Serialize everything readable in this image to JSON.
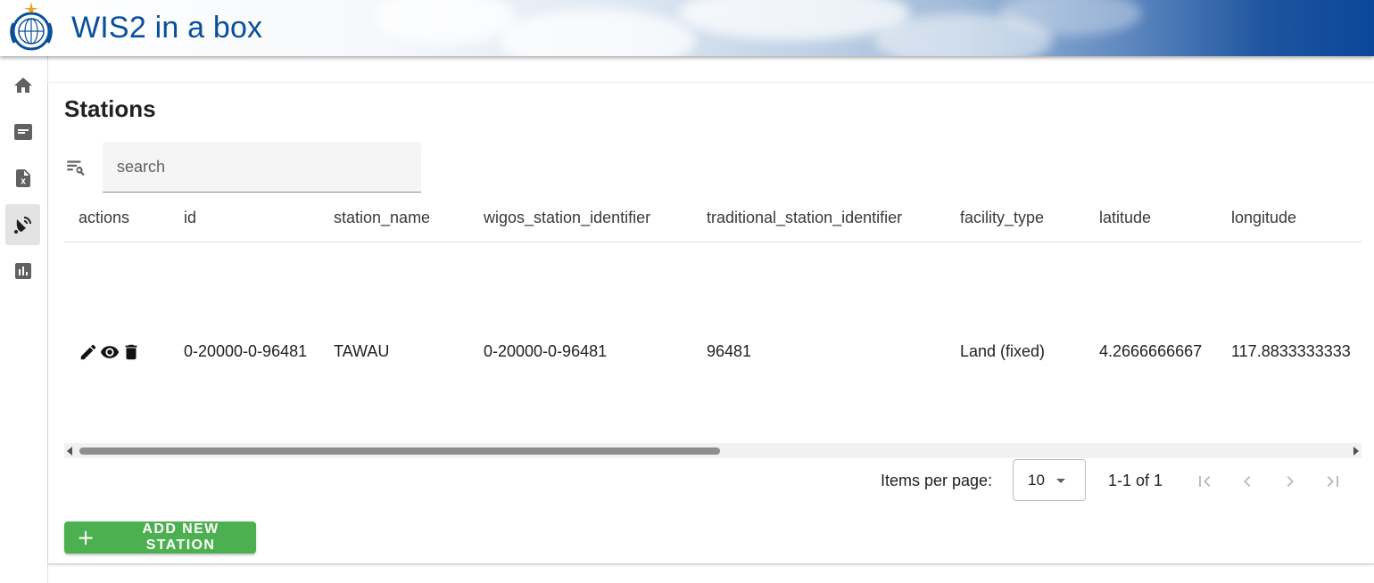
{
  "header": {
    "title": "WIS2 in a box"
  },
  "sidebar": {
    "items": [
      {
        "name": "home",
        "icon": "home-icon",
        "active": false
      },
      {
        "name": "messages",
        "icon": "message-icon",
        "active": false
      },
      {
        "name": "csv",
        "icon": "csv-file-icon",
        "active": false
      },
      {
        "name": "stations",
        "icon": "satellite-dish-icon",
        "active": true
      },
      {
        "name": "monitoring",
        "icon": "bar-chart-icon",
        "active": false
      }
    ]
  },
  "main": {
    "title": "Stations",
    "search": {
      "placeholder": "search",
      "value": ""
    },
    "table": {
      "columns": [
        "actions",
        "id",
        "station_name",
        "wigos_station_identifier",
        "traditional_station_identifier",
        "facility_type",
        "latitude",
        "longitude"
      ],
      "rows": [
        {
          "id": "0-20000-0-96481",
          "station_name": "TAWAU",
          "wigos_station_identifier": "0-20000-0-96481",
          "traditional_station_identifier": "96481",
          "facility_type": "Land (fixed)",
          "latitude": "4.2666666667",
          "longitude": "117.8833333333"
        }
      ]
    },
    "paginator": {
      "items_per_page_label": "Items per page:",
      "items_per_page": "10",
      "range_label": "1-1 of 1"
    },
    "add_button": {
      "label": "ADD NEW STATION"
    }
  },
  "colors": {
    "accent_green": "#4caf50",
    "header_blue": "#0a4f9c"
  }
}
